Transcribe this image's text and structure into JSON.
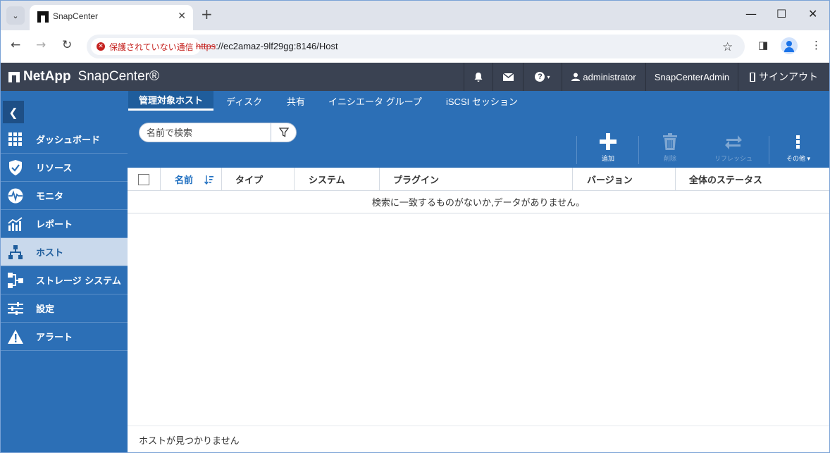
{
  "browser": {
    "tab_title": "SnapCenter",
    "security_label": "保護されていない通信",
    "url_scheme": "https",
    "url_rest": "://ec2amaz-9lf29gg:8146/Host"
  },
  "header": {
    "brand": "NetApp",
    "product": "SnapCenter®",
    "user": "administrator",
    "role": "SnapCenterAdmin",
    "signout": "サインアウト"
  },
  "sidebar": {
    "items": [
      {
        "label": "ダッシュボード",
        "icon": "dashboard-icon"
      },
      {
        "label": "リソース",
        "icon": "shield-icon"
      },
      {
        "label": "モニタ",
        "icon": "monitor-icon"
      },
      {
        "label": "レポート",
        "icon": "report-icon"
      },
      {
        "label": "ホスト",
        "icon": "host-icon"
      },
      {
        "label": "ストレージ システム",
        "icon": "storage-icon"
      },
      {
        "label": "設定",
        "icon": "settings-icon"
      },
      {
        "label": "アラート",
        "icon": "alert-icon"
      }
    ],
    "active_index": 4
  },
  "tabs": [
    "管理対象ホスト",
    "ディスク",
    "共有",
    "イニシエータ グループ",
    "iSCSI セッション"
  ],
  "search": {
    "placeholder": "名前で検索"
  },
  "actions": {
    "add": "追加",
    "delete": "削除",
    "refresh": "リフレッシュ",
    "more": "その他 ▾"
  },
  "table": {
    "columns": [
      "名前",
      "タイプ",
      "システム",
      "プラグイン",
      "バージョン",
      "全体のステータス"
    ],
    "empty_message": "検索に一致するものがないか,データがありません。"
  },
  "footer": {
    "status": "ホストが見つかりません"
  },
  "colors": {
    "sidebar": "#2c6fb6",
    "header": "#3a4252",
    "active_nav": "#c9d9ec"
  }
}
